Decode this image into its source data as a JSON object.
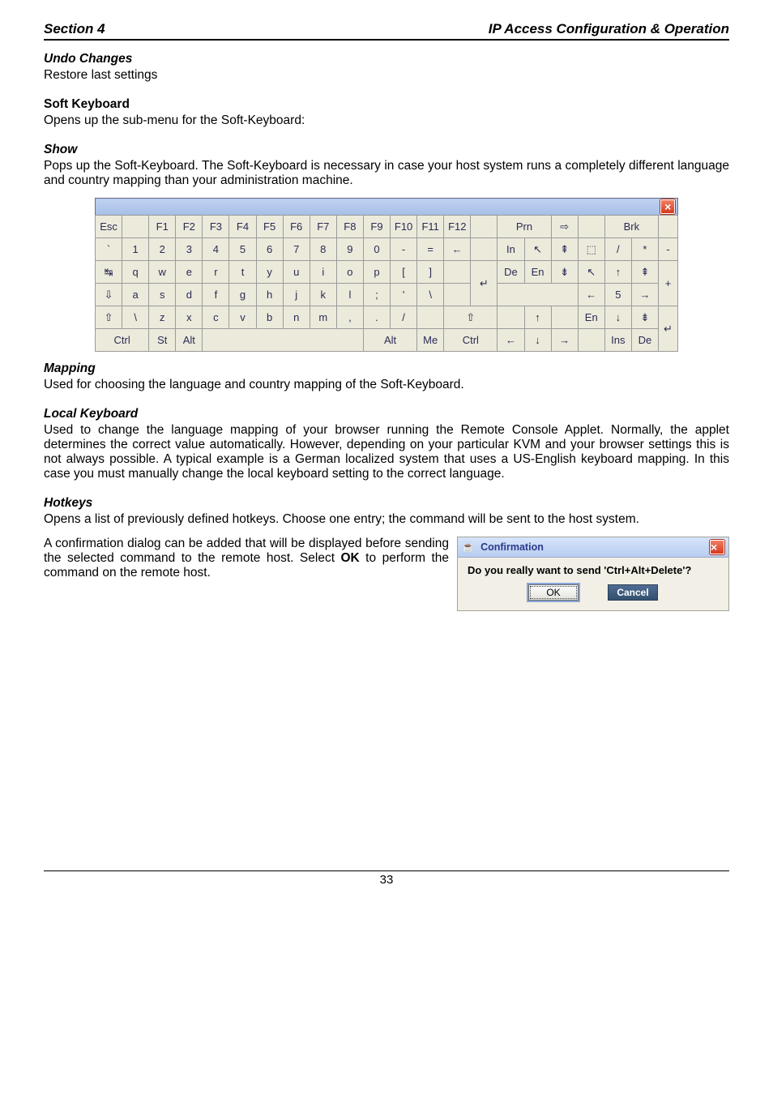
{
  "header": {
    "left": "Section 4",
    "right": "IP Access Configuration & Operation"
  },
  "sections": {
    "undo": {
      "title": "Undo Changes",
      "body": "Restore last settings"
    },
    "softkbd": {
      "title": "Soft Keyboard",
      "body": "Opens up the sub-menu for the Soft-Keyboard:"
    },
    "show": {
      "title": "Show",
      "body": "Pops up the Soft-Keyboard. The Soft-Keyboard is necessary in case your host system runs a completely different language and country mapping than your administration machine."
    },
    "mapping": {
      "title": "Mapping",
      "body": "Used for choosing the language and country mapping of the Soft-Keyboard."
    },
    "localkbd": {
      "title": "Local Keyboard",
      "body": "Used to change the language mapping of your browser running the Remote Console Applet. Normally, the applet determines the correct value automatically. However, depending on your particular KVM and your browser settings this is not always possible. A typical example is a German localized system that uses a US-English keyboard mapping. In this case you must manually change the local keyboard setting to the correct language."
    },
    "hotkeys": {
      "title": "Hotkeys",
      "body1": "Opens a list of previously defined hotkeys. Choose one entry; the command will be sent to the host system.",
      "body2_pre": "A confirmation dialog can be added that will be displayed before sending the selected command to the remote host. Select ",
      "body2_bold": "OK",
      "body2_post": " to perform the command on the remote host."
    }
  },
  "keyboard": {
    "frow": [
      "Esc",
      "",
      "F1",
      "F2",
      "F3",
      "F4",
      "F5",
      "F6",
      "F7",
      "F8",
      "F9",
      "F10",
      "F11",
      "F12",
      "",
      "Prn",
      "",
      "⇨",
      "",
      "Brk",
      ""
    ],
    "r1": [
      "`",
      "1",
      "2",
      "3",
      "4",
      "5",
      "6",
      "7",
      "8",
      "9",
      "0",
      "-",
      "=",
      "←",
      "",
      "In",
      "↖",
      "⇞",
      "⬚",
      "/",
      "*",
      "-"
    ],
    "r2": [
      "↹",
      "q",
      "w",
      "e",
      "r",
      "t",
      "y",
      "u",
      "i",
      "o",
      "p",
      "[",
      "]",
      "",
      "",
      "De",
      "En",
      "⇟",
      "↖",
      "↑",
      "⇞"
    ],
    "r3": [
      "⇩",
      "a",
      "s",
      "d",
      "f",
      "g",
      "h",
      "j",
      "k",
      "l",
      ";",
      "'",
      "\\",
      "",
      "",
      "",
      "",
      "",
      "←",
      "5",
      "→"
    ],
    "r4": [
      "⇧",
      "\\",
      "z",
      "x",
      "c",
      "v",
      "b",
      "n",
      "m",
      ",",
      ".",
      "/",
      "",
      "⇧",
      "",
      "↑",
      "",
      "En",
      "↓",
      "⇟",
      ""
    ],
    "r5": [
      "Ctrl",
      "",
      "St",
      "Alt",
      "",
      "",
      "",
      "",
      "",
      "",
      "Alt",
      "",
      "Me",
      "",
      "Ctrl",
      "←",
      "↓",
      "→",
      "",
      "Ins",
      "De"
    ],
    "plus": "+",
    "enter": "↵"
  },
  "dialog": {
    "title": "Confirmation",
    "message": "Do you really want to send 'Ctrl+Alt+Delete'?",
    "ok": "OK",
    "cancel": "Cancel"
  },
  "footer": {
    "page": "33"
  }
}
